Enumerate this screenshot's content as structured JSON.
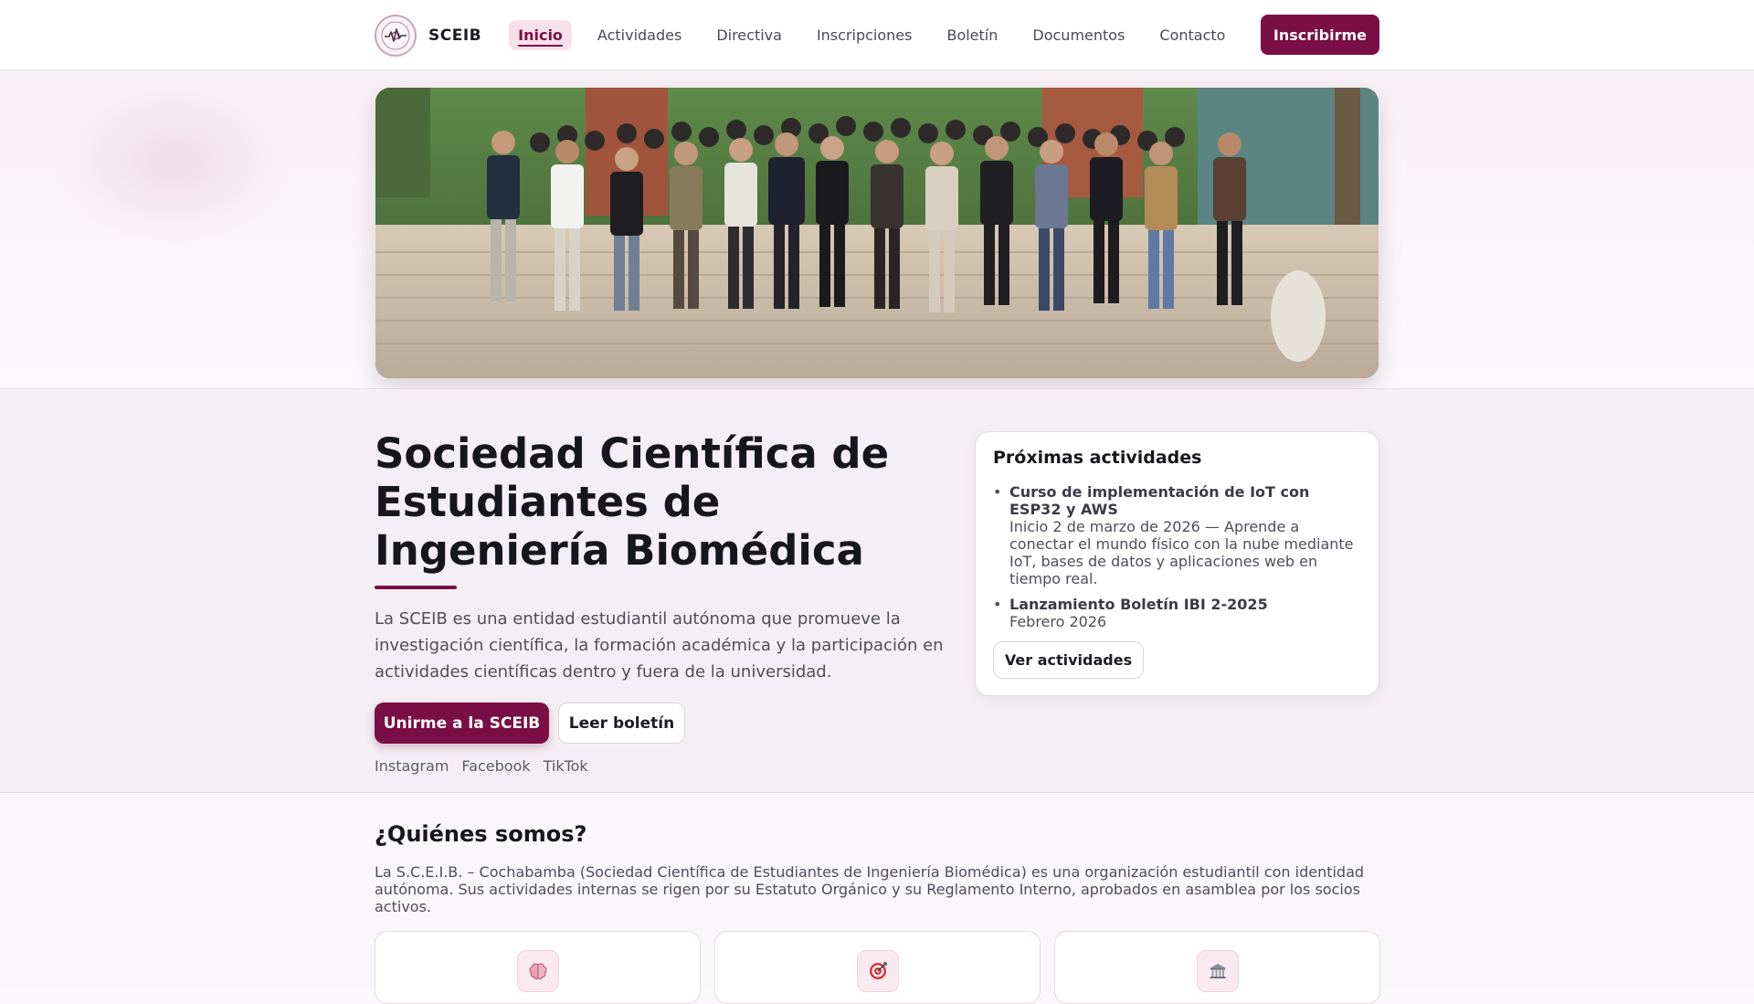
{
  "nav": {
    "brand": "SCEIB",
    "links": [
      "Inicio",
      "Actividades",
      "Directiva",
      "Inscripciones",
      "Boletín",
      "Documentos",
      "Contacto"
    ],
    "active": "Inicio",
    "cta": "Inscribirme"
  },
  "hero": {
    "title": "Sociedad Científica de Estudiantes de Ingeniería Biomédica",
    "lead": "La SCEIB es una entidad estudiantil autónoma que promueve la investigación científica, la formación académica y la participación en actividades científicas dentro y fuera de la universidad.",
    "primary_button": "Unirme a la SCEIB",
    "secondary_button": "Leer boletín",
    "socials": [
      "Instagram",
      "Facebook",
      "TikTok"
    ]
  },
  "upcoming": {
    "title": "Próximas actividades",
    "items": [
      {
        "title": "Curso de implementación de IoT con ESP32 y AWS",
        "detail": "Inicio 2 de marzo de 2026 — Aprende a conectar el mundo físico con la nube mediante IoT, bases de datos y aplicaciones web en tiempo real."
      },
      {
        "title": "Lanzamiento Boletín IBI 2-2025",
        "detail": "Febrero 2026"
      }
    ],
    "button": "Ver actividades"
  },
  "about": {
    "title": "¿Quiénes somos?",
    "text": "La S.C.E.I.B. – Cochabamba (Sociedad Científica de Estudiantes de Ingeniería Biomédica) es una organización estudiantil con identidad autónoma. Sus actividades internas se rigen por su Estatuto Orgánico y su Reglamento Interno, aprobados en asamblea por los socios activos.",
    "feature_icons": [
      "brain-icon",
      "target-icon",
      "institution-icon"
    ]
  },
  "colors": {
    "accent": "#7a0e46",
    "active_bg": "#f6e1ea"
  }
}
